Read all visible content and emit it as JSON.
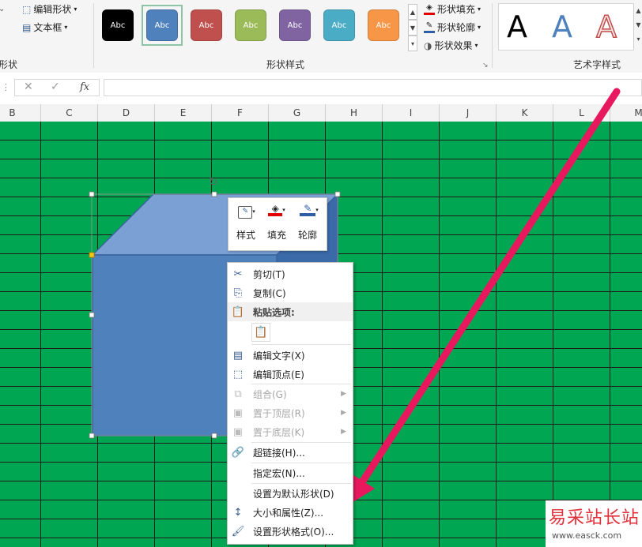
{
  "ribbon": {
    "edit_shape": "编辑形状",
    "text_box": "文本框",
    "insert_shapes_group": "形状",
    "shape_styles_group": "形状样式",
    "wordart_group": "艺术字样式",
    "swatch_text": "Abc",
    "swatches": [
      {
        "color": "#000000"
      },
      {
        "color": "#4f81bd"
      },
      {
        "color": "#c0504d"
      },
      {
        "color": "#9bbb59"
      },
      {
        "color": "#8064a2"
      },
      {
        "color": "#4bacc6"
      },
      {
        "color": "#f79646"
      }
    ],
    "shape_fill": "形状填充",
    "shape_outline": "形状轮廓",
    "shape_effects": "形状效果",
    "wordart_letter": "A"
  },
  "formula_bar": {
    "cancel": "✕",
    "confirm": "✓",
    "fx": "fx",
    "value": ""
  },
  "columns": [
    "B",
    "C",
    "D",
    "E",
    "F",
    "G",
    "H",
    "I",
    "J",
    "K",
    "L",
    "M"
  ],
  "mini_toolbar": {
    "style": "样式",
    "fill": "填充",
    "outline": "轮廓"
  },
  "context_menu": {
    "cut": "剪切(T)",
    "copy": "复制(C)",
    "paste_options": "粘贴选项:",
    "edit_text": "编辑文字(X)",
    "edit_points": "编辑顶点(E)",
    "group": "组合(G)",
    "bring_to_front": "置于顶层(R)",
    "send_to_back": "置于底层(K)",
    "hyperlink": "超链接(H)...",
    "assign_macro": "指定宏(N)...",
    "set_default": "设置为默认形状(D)",
    "size_props": "大小和属性(Z)...",
    "format_shape": "设置形状格式(O)..."
  },
  "watermark": {
    "title": "易采站长站",
    "url": "www.easck.com"
  },
  "colors": {
    "sheet_bg": "#00a651",
    "cube_front": "#4f81bd",
    "arrow": "#e8185f"
  }
}
